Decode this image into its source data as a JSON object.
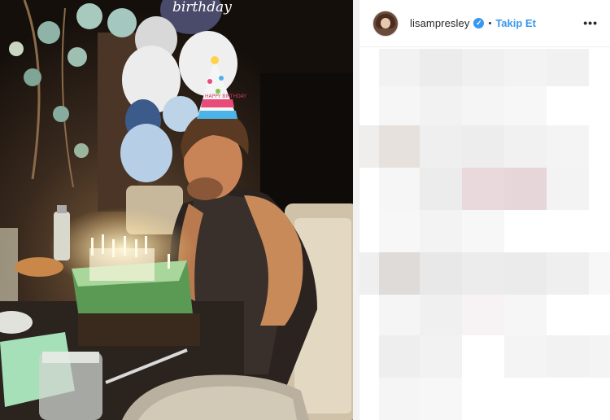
{
  "photo": {
    "balloon_text": "birthday",
    "hat_text": "HAPPY BIRTHDAY"
  },
  "header": {
    "username": "lisampresley",
    "verified_icon": "verified-badge-icon",
    "separator": "•",
    "follow_label": "Takip Et",
    "more_icon": "more-options-icon",
    "more_label": "•••"
  },
  "blurred_comments": {
    "style": "pixelated",
    "colors": [
      "#f4f4f4",
      "#eeeeee",
      "#e6e1dc",
      "#e9d9dc",
      "#f7f2f3"
    ]
  }
}
